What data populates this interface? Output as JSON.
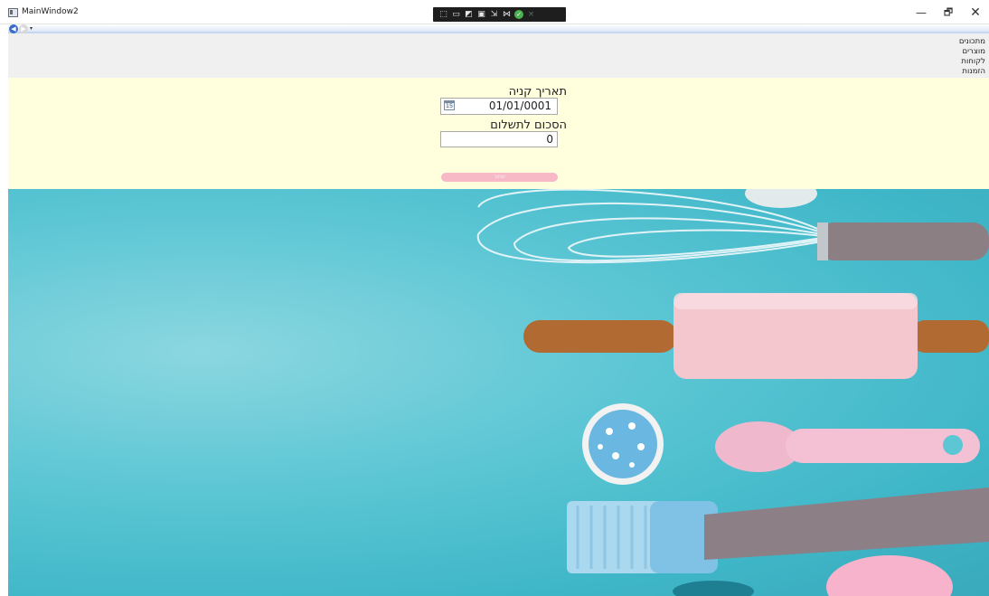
{
  "window": {
    "title": "MainWindow2",
    "controls": {
      "minimize": "—",
      "restore": "🗗",
      "close": "✕"
    }
  },
  "debug_toolbar": {
    "label_live": "⤓"
  },
  "navigation": {
    "back": "◀",
    "forward": "▶",
    "dropdown": "▾"
  },
  "menu": {
    "items": [
      {
        "label": "מתכונים"
      },
      {
        "label": "מוצרים"
      },
      {
        "label": "לקוחות"
      },
      {
        "label": "הזמנות"
      }
    ]
  },
  "form": {
    "purchase_date_label": "תאריך קניה",
    "purchase_date_value": "01/01/0001",
    "calendar_icon_text": "15",
    "amount_label": "הסכום לתשלום",
    "amount_value": "0",
    "save_button_label": "שמור"
  },
  "colors": {
    "form_background": "#fffedd",
    "menu_background": "#f0f0f0",
    "save_button": "#f7b9c6",
    "photo_background": "#5cc6d4"
  }
}
